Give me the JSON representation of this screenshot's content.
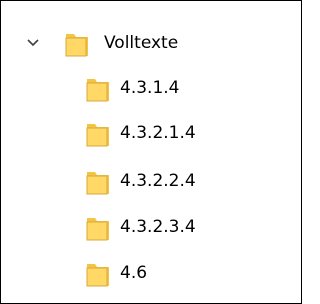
{
  "tree": {
    "root": {
      "label": "Volltexte",
      "expanded_icon": "chevron-down-icon",
      "icon": "folder-icon"
    },
    "children": [
      {
        "label": "4.3.1.4",
        "icon": "folder-icon"
      },
      {
        "label": "4.3.2.1.4",
        "icon": "folder-icon"
      },
      {
        "label": "4.3.2.2.4",
        "icon": "folder-icon"
      },
      {
        "label": "4.3.2.3.4",
        "icon": "folder-icon"
      },
      {
        "label": "4.6",
        "icon": "folder-icon"
      }
    ]
  },
  "colors": {
    "folder_fill": "#FFD866",
    "folder_edge": "#D9A93A",
    "folder_back": "#F4C443",
    "chevron": "#404040",
    "border": "#000000"
  }
}
